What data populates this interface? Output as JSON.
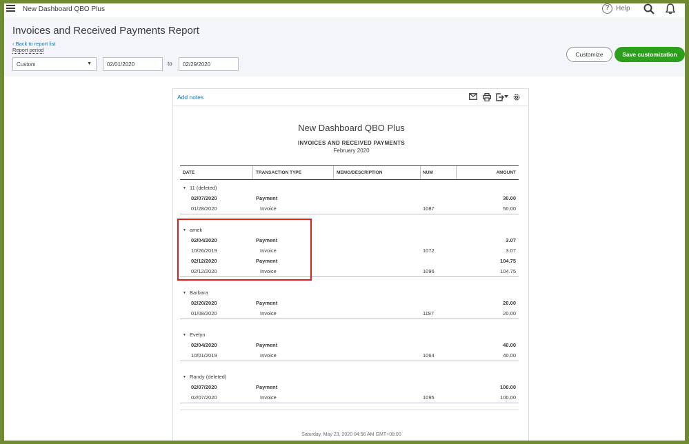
{
  "topbar": {
    "company": "New Dashboard QBO Plus",
    "help_label": "Help"
  },
  "header": {
    "title": "Invoices and Received Payments Report",
    "back_link": "Back to report list",
    "period_label": "Report period",
    "period_value": "Custom",
    "date_from": "02/01/2020",
    "to_label": "to",
    "date_to": "02/29/2020",
    "customize_label": "Customize",
    "save_label": "Save customization"
  },
  "report": {
    "add_notes": "Add notes",
    "company": "New Dashboard QBO Plus",
    "title": "INVOICES AND RECEIVED PAYMENTS",
    "period": "February 2020",
    "columns": [
      "DATE",
      "TRANSACTION TYPE",
      "MEMO/DESCRIPTION",
      "NUM",
      "AMOUNT"
    ],
    "groups": [
      {
        "name": "11 (deleted)",
        "rows": [
          {
            "date": "02/07/2020",
            "type": "Payment",
            "num": "",
            "amount": "30.00",
            "bold": true
          },
          {
            "date": "01/28/2020",
            "type": "Invoice",
            "num": "1087",
            "amount": "50.00",
            "bold": false
          }
        ]
      },
      {
        "name": "amek",
        "rows": [
          {
            "date": "02/04/2020",
            "type": "Payment",
            "num": "",
            "amount": "3.07",
            "bold": true
          },
          {
            "date": "10/26/2019",
            "type": "Invoice",
            "num": "1072",
            "amount": "3.07",
            "bold": false
          },
          {
            "date": "02/12/2020",
            "type": "Payment",
            "num": "",
            "amount": "104.75",
            "bold": true
          },
          {
            "date": "02/12/2020",
            "type": "Invoice",
            "num": "1096",
            "amount": "104.75",
            "bold": false
          }
        ]
      },
      {
        "name": "Barbara",
        "rows": [
          {
            "date": "02/20/2020",
            "type": "Payment",
            "num": "",
            "amount": "20.00",
            "bold": true
          },
          {
            "date": "01/08/2020",
            "type": "Invoice",
            "num": "1187",
            "amount": "20.00",
            "bold": false
          }
        ]
      },
      {
        "name": "Evelyn",
        "rows": [
          {
            "date": "02/04/2020",
            "type": "Payment",
            "num": "",
            "amount": "40.00",
            "bold": true
          },
          {
            "date": "10/01/2019",
            "type": "Invoice",
            "num": "1064",
            "amount": "40.00",
            "bold": false
          }
        ]
      },
      {
        "name": "Randy (deleted)",
        "rows": [
          {
            "date": "02/07/2020",
            "type": "Payment",
            "num": "",
            "amount": "100.00",
            "bold": true
          },
          {
            "date": "02/07/2020",
            "type": "Invoice",
            "num": "1095",
            "amount": "100.00",
            "bold": false
          }
        ]
      }
    ],
    "footer": "Saturday, May 23, 2020  04:56 AM GMT+08:00"
  },
  "colors": {
    "accent_green": "#2ca01c",
    "link_blue": "#0077c5",
    "highlight_red": "#e21f1f",
    "outer_border": "#6f8a31"
  },
  "icons": [
    "menu-icon",
    "help-icon",
    "search-icon",
    "bell-icon",
    "mail-icon",
    "print-icon",
    "export-icon",
    "gear-icon",
    "chevron-down-icon"
  ]
}
